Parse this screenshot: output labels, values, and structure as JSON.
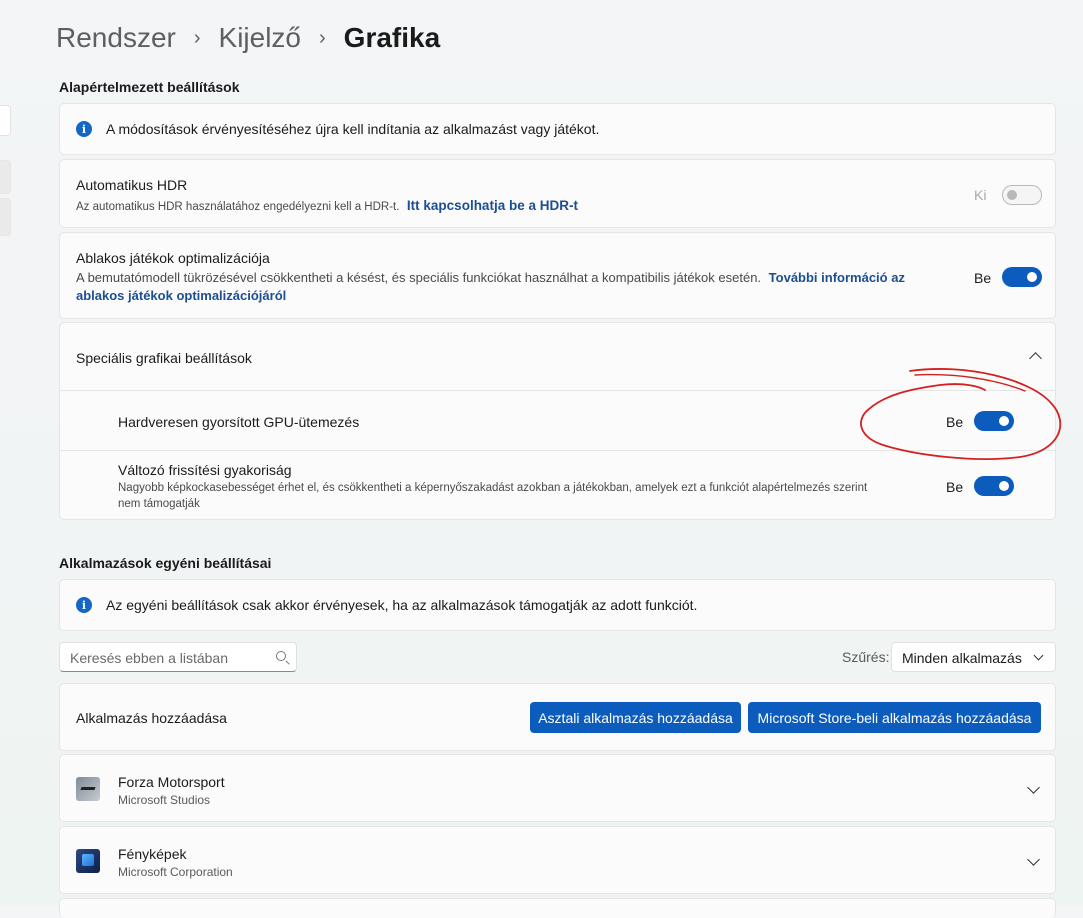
{
  "breadcrumb": {
    "item1": "Rendszer",
    "item2": "Kijelző",
    "current": "Grafika"
  },
  "default_settings": {
    "section_title": "Alapértelmezett beállítások",
    "info_text": "A módosítások érvényesítéséhez újra kell indítania az alkalmazást vagy játékot.",
    "auto_hdr": {
      "title": "Automatikus HDR",
      "desc": "Az automatikus HDR használatához engedélyezni kell a HDR-t.",
      "link": "Itt kapcsolhatja be a HDR-t",
      "state_label": "Ki",
      "enabled": false
    },
    "windowed_opt": {
      "title": "Ablakos játékok optimalizációja",
      "desc": "A bemutatómodell tükrözésével csökkentheti a késést, és speciális funkciókat használhat a kompatibilis játékok esetén.",
      "link_part1": "További információ az",
      "link_part2": "ablakos játékok optimalizációjáról",
      "state_label": "Be",
      "enabled": true
    },
    "advanced": {
      "title": "Speciális grafikai beállítások",
      "expanded": true,
      "hags": {
        "title": "Hardveresen gyorsított GPU-ütemezés",
        "state_label": "Be",
        "enabled": true
      },
      "vrr": {
        "title": "Változó frissítési gyakoriság",
        "desc_line1": "Nagyobb képkockasebességet érhet el, és csökkentheti a képernyőszakadást azokban a játékokban, amelyek ezt a funkciót alapértelmezés szerint",
        "desc_line2": "nem támogatják",
        "state_label": "Be",
        "enabled": true
      }
    }
  },
  "app_settings": {
    "section_title": "Alkalmazások egyéni beállításai",
    "info_text": "Az egyéni beállítások csak akkor érvényesek, ha az alkalmazások támogatják az adott funkciót.",
    "search_placeholder": "Keresés ebben a listában",
    "filter_label": "Szűrés:",
    "filter_value": "Minden alkalmazás",
    "add_app_label": "Alkalmazás hozzáadása",
    "add_desktop_button": "Asztali alkalmazás hozzáadása",
    "add_store_button": "Microsoft Store-beli alkalmazás hozzáadása",
    "apps": [
      {
        "name": "Forza Motorsport",
        "publisher": "Microsoft Studios",
        "icon": "forza-icon"
      },
      {
        "name": "Fényképek",
        "publisher": "Microsoft Corporation",
        "icon": "photos-icon"
      }
    ]
  },
  "colors": {
    "accent": "#0b5cbd",
    "link": "#1d4e91",
    "annotation": "#d42020"
  }
}
